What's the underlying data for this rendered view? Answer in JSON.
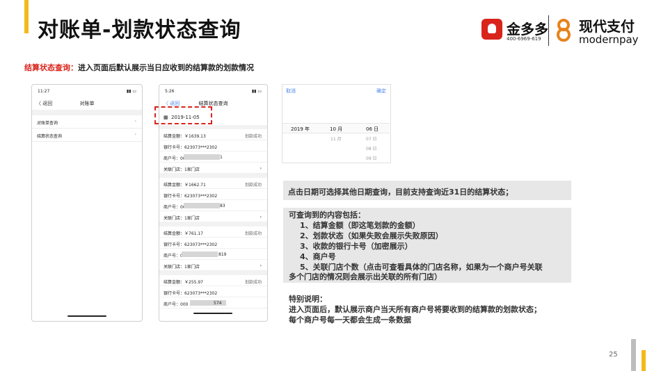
{
  "header": {
    "title": "对账单-划款状态查询",
    "brand1_name": "金多多",
    "brand1_phone": "400-6969-619",
    "brand2_name": "现代支付",
    "brand2_en": "modernpay"
  },
  "subheading": {
    "label": "结算状态查询：",
    "text": "进入页面后默认展示当日应收到的结算款的划款情况"
  },
  "phone1": {
    "time": "11:27",
    "back": "〈 返回",
    "title": "对账单",
    "items": [
      {
        "label": "对账单查询",
        "arrow": "›"
      },
      {
        "label": "结算状态查询",
        "arrow": "›"
      }
    ]
  },
  "phone2": {
    "time": "5:26",
    "back": "〈 返回",
    "title": "结算状态查询",
    "date": "2019-11-05",
    "cards": [
      {
        "amount": "结算金额：￥1639.13",
        "status": "划款成功",
        "card": "银行卡号：623073***2302",
        "merchant": "商户号：00",
        "merchant_tail": "1",
        "stores": "关联门店：1家门店",
        "arrow": "›"
      },
      {
        "amount": "结算金额：￥1662.71",
        "status": "划款成功",
        "card": "银行卡号：623073***2302",
        "merchant": "商户号：00",
        "merchant_tail": "83",
        "stores": "关联门店：1家门店",
        "arrow": "›"
      },
      {
        "amount": "结算金额：￥761.17",
        "status": "划款成功",
        "card": "银行卡号：623073***2302",
        "merchant": "商户号：0",
        "merchant_tail": "819",
        "stores": "关联门店：1家门店",
        "arrow": "›"
      },
      {
        "amount": "结算金额：￥255.97",
        "status": "划款成功",
        "card": "银行卡号：623073***2302",
        "merchant": "商户号：000",
        "merchant_tail": "574"
      }
    ]
  },
  "picker": {
    "cancel": "取消",
    "confirm": "确定",
    "year": "2019 年",
    "months": [
      "10 月",
      "11 月"
    ],
    "days": [
      "06 日",
      "07 日",
      "08 日",
      "09 日"
    ]
  },
  "notes": {
    "tip": "点击日期可选择其他日期查询，目前支持查询近31日的结算状态；",
    "content_title": "可查询到的内容包括：",
    "content_items": [
      "1、结算金额（即这笔划款的金额）",
      "2、划款状态（如果失败会展示失败原因）",
      "3、收款的银行卡号（加密展示）",
      "4、商户号",
      "5、关联门店个数（点击可查看具体的门店名称，如果为一个商户号关联"
    ],
    "content_tail": "多个门店的情况则会展示出关联的所有门店）",
    "special_title": "特别说明：",
    "special_lines": [
      "进入页面后，默认展示商户当天所有商户号将要收到的结算款的划款状态；",
      "每个商户号每一天都会生成一条数据"
    ]
  },
  "page_number": "25",
  "colors": {
    "accent": "#f5b81c",
    "red": "#d9241c",
    "link": "#4a86e8"
  }
}
